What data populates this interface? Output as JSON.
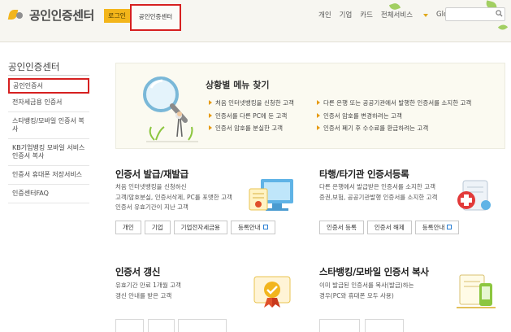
{
  "header": {
    "logo_text": "공인인증센터",
    "login_label": "로그인",
    "highlight_tab": "공인인증센터",
    "nav": [
      "개인",
      "기업",
      "카드"
    ],
    "all_services": "전체서비스",
    "global": "Global",
    "search_placeholder": ""
  },
  "sidebar": {
    "title": "공인인증센터",
    "items": [
      {
        "label": "공인인증서"
      },
      {
        "label": "전자세금용 인증서"
      },
      {
        "label": "스타뱅킹/모바일 인증서 복사"
      },
      {
        "label": "KB기업뱅킹 모바일 서비스 인증서 복사"
      },
      {
        "label": "인증서 휴대폰 저장서비스"
      },
      {
        "label": "인증센터FAQ"
      }
    ]
  },
  "banner": {
    "title": "상황별 메뉴 찾기",
    "tips": [
      "처음 인터넷뱅킹을 신청한 고객",
      "인증서를 다른 PC에 둔 고객",
      "인증서 암호를 분실한 고객",
      "다른 은행 또는 공공기관에서 발행한 인증서를 소지한 고객",
      "인증서 암호를 변경하려는 고객",
      "인증서 폐기 후 수수료를 환급하려는 고객"
    ]
  },
  "sections": {
    "issue": {
      "title": "인증서 발급/재발급",
      "desc": [
        "처음 인터넷뱅킹을 신청하신",
        "고객/암호분실, 인증서삭제, PC를 포맷한 고객",
        "인증서 유효기간이 지난 고객"
      ],
      "buttons": [
        "개인",
        "기업",
        "기업전자세금용",
        "등록안내"
      ]
    },
    "register": {
      "title": "타행/타기관 인증서등록",
      "desc": [
        "다른 은행에서 발급받은 인증서를 소지한 고객",
        "증권,보험, 공공기관발행 인증서를 소지한 고객"
      ],
      "buttons": [
        "인증서 등록",
        "인증서 해제",
        "등록안내"
      ]
    },
    "renew": {
      "title": "인증서 갱신",
      "desc": [
        "유효기간 만료 1개월 고객",
        "갱신 안내를 받은 고객"
      ]
    },
    "copy": {
      "title": "스타뱅킹/모바일 인증서 복사",
      "desc": [
        "이미 발급된 인증서를 복사(발급)하는",
        "경우(PC와 휴대폰 모두 사용)"
      ]
    }
  },
  "colors": {
    "accent": "#f3b51a",
    "highlight_border": "#d62020",
    "tip_arrow": "#e69a12",
    "link_icon": "#2a7fd4"
  }
}
